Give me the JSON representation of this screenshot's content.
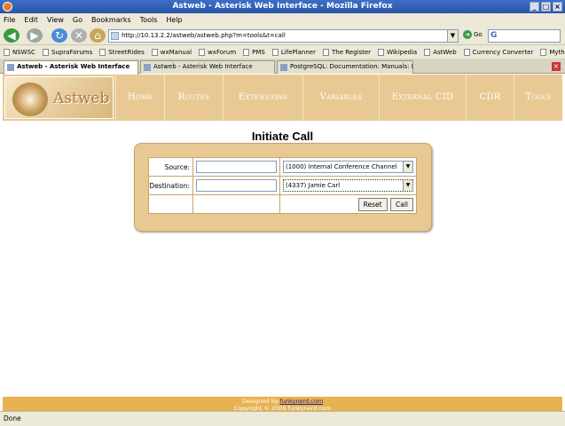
{
  "window": {
    "title": "Astweb - Asterisk Web Interface - Mozilla Firefox"
  },
  "menu": [
    "File",
    "Edit",
    "View",
    "Go",
    "Bookmarks",
    "Tools",
    "Help"
  ],
  "address": {
    "url": "http://10.13.2.2/astweb/astweb.php?m=tools&t=call",
    "go_label": "Go"
  },
  "bookmarks": [
    "NSWSC",
    "SupraForums",
    "StreetRides",
    "wxManual",
    "wxForum",
    "PMS",
    "LifePlanner",
    "The Register",
    "Wikipedia",
    "AstWeb",
    "Currency Converter",
    "MythEPG"
  ],
  "tabs": [
    {
      "label": "Astweb - Asterisk Web Interface",
      "active": true
    },
    {
      "label": "Astweb - Asterisk Web Interface",
      "active": false
    },
    {
      "label": "PostgreSQL: Documentation: Manuals: Post...",
      "active": false
    }
  ],
  "site": {
    "logo_text": "Astweb",
    "nav": [
      "Home",
      "Routes",
      "Extensions",
      "Variables",
      "External CID",
      "CDR",
      "Tools"
    ]
  },
  "page": {
    "title": "Initiate Call"
  },
  "form": {
    "source_label": "Source:",
    "destination_label": "Destination:",
    "source_value": "",
    "destination_value": "",
    "source_select": "(1000) Internal Conference Channel",
    "destination_select": "(4337) Jamie Carl",
    "reset_label": "Reset",
    "call_label": "Call"
  },
  "footer": {
    "designed_prefix": "Designed by",
    "designer": "funkynerd.com",
    "copyright": "Copyright © 2006 funkynerd.com"
  },
  "status": {
    "text": "Done"
  }
}
